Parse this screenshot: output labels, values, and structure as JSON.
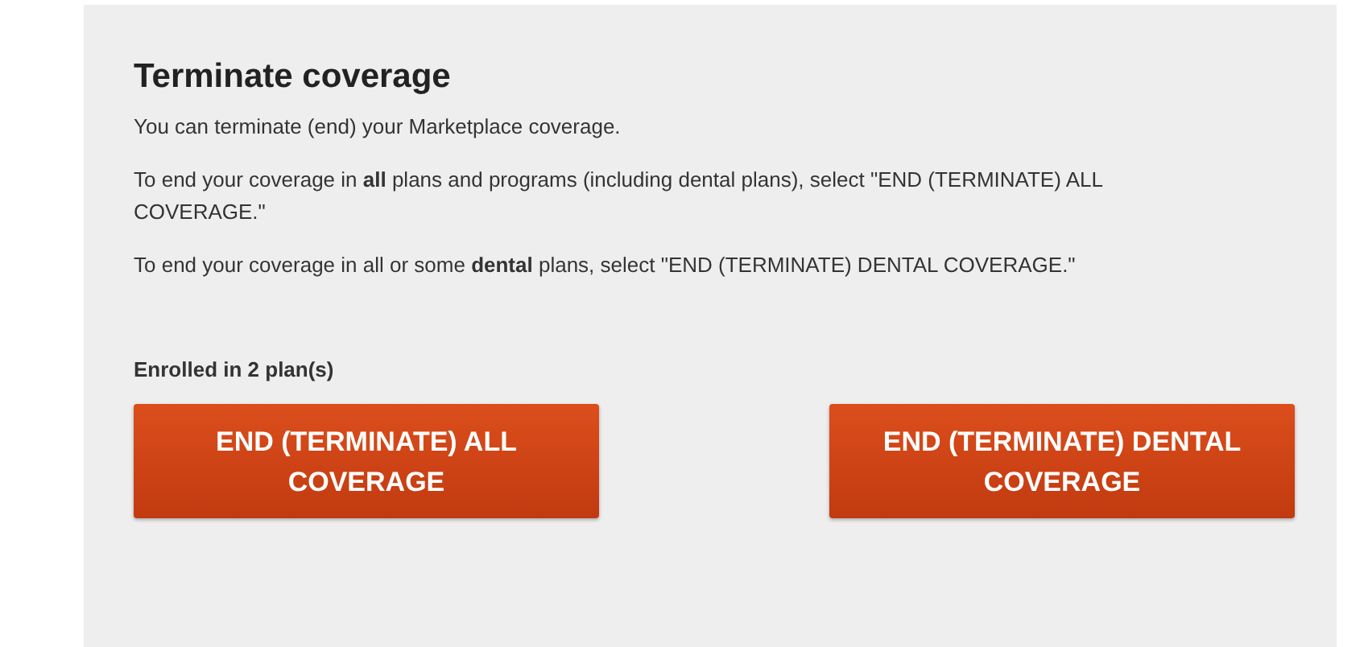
{
  "title": "Terminate coverage",
  "paragraphs": [
    "You can terminate (end) your Marketplace coverage.",
    "To end your coverage in **all** plans and programs (including dental plans), select \"END (TERMINATE) ALL COVERAGE.\"",
    "To end your coverage in all or some **dental** plans, select \"END (TERMINATE) DENTAL COVERAGE.\""
  ],
  "enrollment": "Enrolled in 2 plan(s)",
  "buttons": [
    {
      "label": "END (TERMINATE) ALL COVERAGE"
    },
    {
      "label": "END (TERMINATE) DENTAL COVERAGE"
    }
  ]
}
